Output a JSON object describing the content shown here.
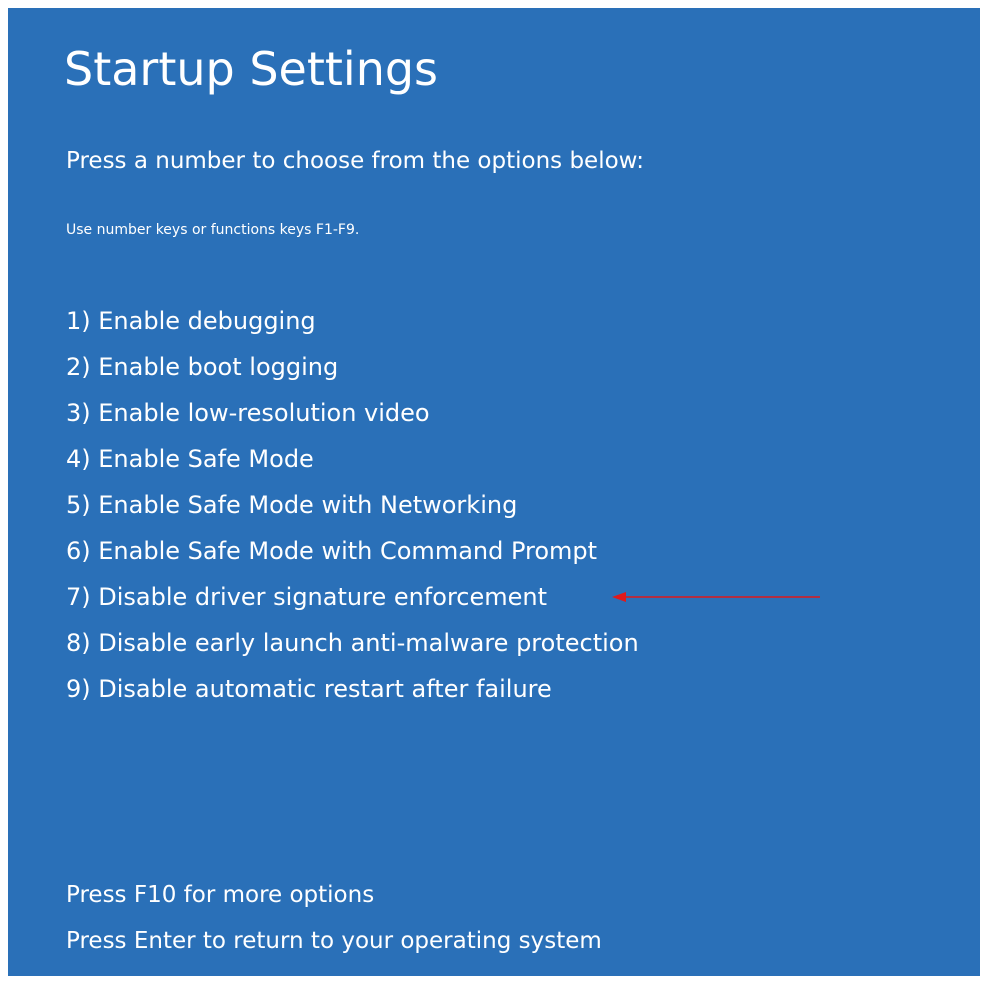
{
  "screen": {
    "title": "Startup Settings",
    "subtitle": "Press a number to choose from the options below:",
    "hint": "Use number keys or functions keys F1-F9.",
    "background_color": "#2a70b8",
    "text_color": "#ffffff"
  },
  "options": [
    {
      "label": "1) Enable debugging"
    },
    {
      "label": "2) Enable boot logging"
    },
    {
      "label": "3) Enable low-resolution video"
    },
    {
      "label": "4) Enable Safe Mode"
    },
    {
      "label": "5) Enable Safe Mode with Networking"
    },
    {
      "label": "6) Enable Safe Mode with Command Prompt"
    },
    {
      "label": "7) Disable driver signature enforcement"
    },
    {
      "label": "8) Disable early launch anti-malware protection"
    },
    {
      "label": "9) Disable automatic restart after failure"
    }
  ],
  "annotation": {
    "icon": "left-arrow-icon",
    "color": "#e0191b",
    "points_to_option": 7
  },
  "footer": {
    "more_options": "Press F10 for more options",
    "return": "Press Enter to return to your operating system"
  }
}
